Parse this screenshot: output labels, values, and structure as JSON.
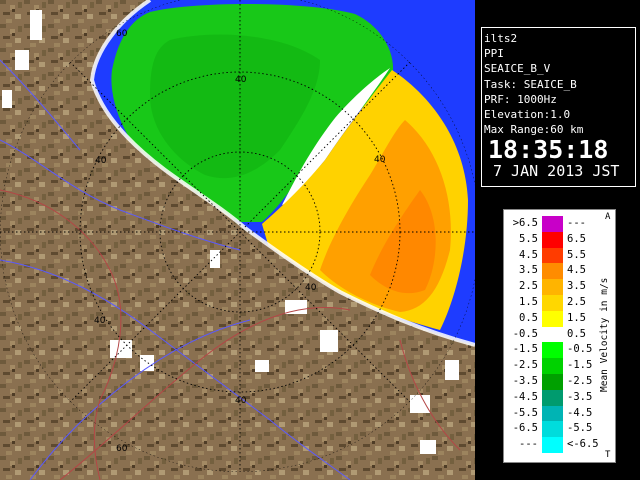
{
  "radar": {
    "range_rings": [
      "40",
      "40",
      "60",
      "40",
      "40",
      "60",
      "40",
      "40"
    ]
  },
  "info": {
    "lines": [
      "ilts2",
      "PPI",
      "SEAICE_B_V",
      "Task: SEAICE_B",
      "PRF: 1000Hz",
      "Elevation:1.0",
      "Max Range:60 km"
    ],
    "time": "18:35:18",
    "date": "7 JAN 2013 JST"
  },
  "legend": {
    "title": "Mean Velocity in m/s",
    "corner_top": "A",
    "corner_bottom": "T",
    "rows": [
      {
        "left": ">6.5",
        "right": "---",
        "color": "#c800c8"
      },
      {
        "left": "5.5",
        "right": "6.5",
        "color": "#ff0000"
      },
      {
        "left": "4.5",
        "right": "5.5",
        "color": "#ff3c00"
      },
      {
        "left": "3.5",
        "right": "4.5",
        "color": "#ff8c00"
      },
      {
        "left": "2.5",
        "right": "3.5",
        "color": "#ffb400"
      },
      {
        "left": "1.5",
        "right": "2.5",
        "color": "#ffd700"
      },
      {
        "left": "0.5",
        "right": "1.5",
        "color": "#ffff00"
      },
      {
        "left": "-0.5",
        "right": "0.5",
        "color": "#ffffff"
      },
      {
        "left": "-1.5",
        "right": "-0.5",
        "color": "#00ff00"
      },
      {
        "left": "-2.5",
        "right": "-1.5",
        "color": "#00d200"
      },
      {
        "left": "-3.5",
        "right": "-2.5",
        "color": "#00a000"
      },
      {
        "left": "-4.5",
        "right": "-3.5",
        "color": "#009b6e"
      },
      {
        "left": "-5.5",
        "right": "-4.5",
        "color": "#00b4b4"
      },
      {
        "left": "-6.5",
        "right": "-5.5",
        "color": "#00dcdc"
      },
      {
        "left": "---",
        "right": "<-6.5",
        "color": "#00ffff"
      }
    ]
  },
  "colors": {
    "sea": "#1e3cff",
    "land": "#8a7050",
    "approaching_echo": "#18c818",
    "receding_echo": "#ffb400"
  }
}
